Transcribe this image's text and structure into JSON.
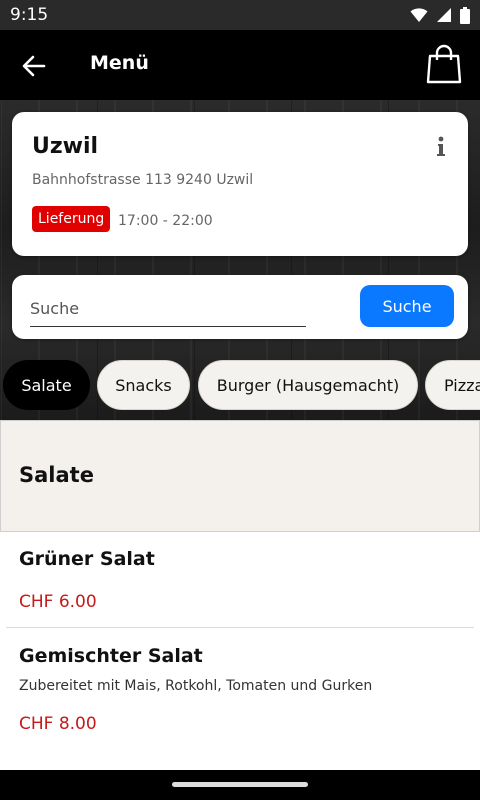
{
  "status_bar": {
    "time": "9:15"
  },
  "app_bar": {
    "title": "Menü",
    "back_icon": "arrow-left-icon",
    "cart_icon": "shopping-bag-icon"
  },
  "store": {
    "name": "Uzwil",
    "address": "Bahnhofstrasse 113 9240 Uzwil",
    "delivery_badge": "Lieferung",
    "hours": "17:00 - 22:00",
    "badge_color": "#e10000"
  },
  "search": {
    "placeholder": "Suche",
    "value": "",
    "button_label": "Suche",
    "button_color": "#0a78ff"
  },
  "categories": [
    {
      "label": "Salate",
      "active": true
    },
    {
      "label": "Snacks",
      "active": false
    },
    {
      "label": "Burger (Hausgemacht)",
      "active": false
    },
    {
      "label": "Pizza",
      "active": false
    }
  ],
  "section": {
    "title": "Salate"
  },
  "items": [
    {
      "name": "Grüner Salat",
      "description": "",
      "price": "CHF 6.00"
    },
    {
      "name": "Gemischter Salat",
      "description": "Zubereitet mit Mais, Rotkohl, Tomaten und Gurken",
      "price": "CHF 8.00"
    }
  ],
  "colors": {
    "price": "#c41a1a",
    "appbar": "#000000"
  }
}
